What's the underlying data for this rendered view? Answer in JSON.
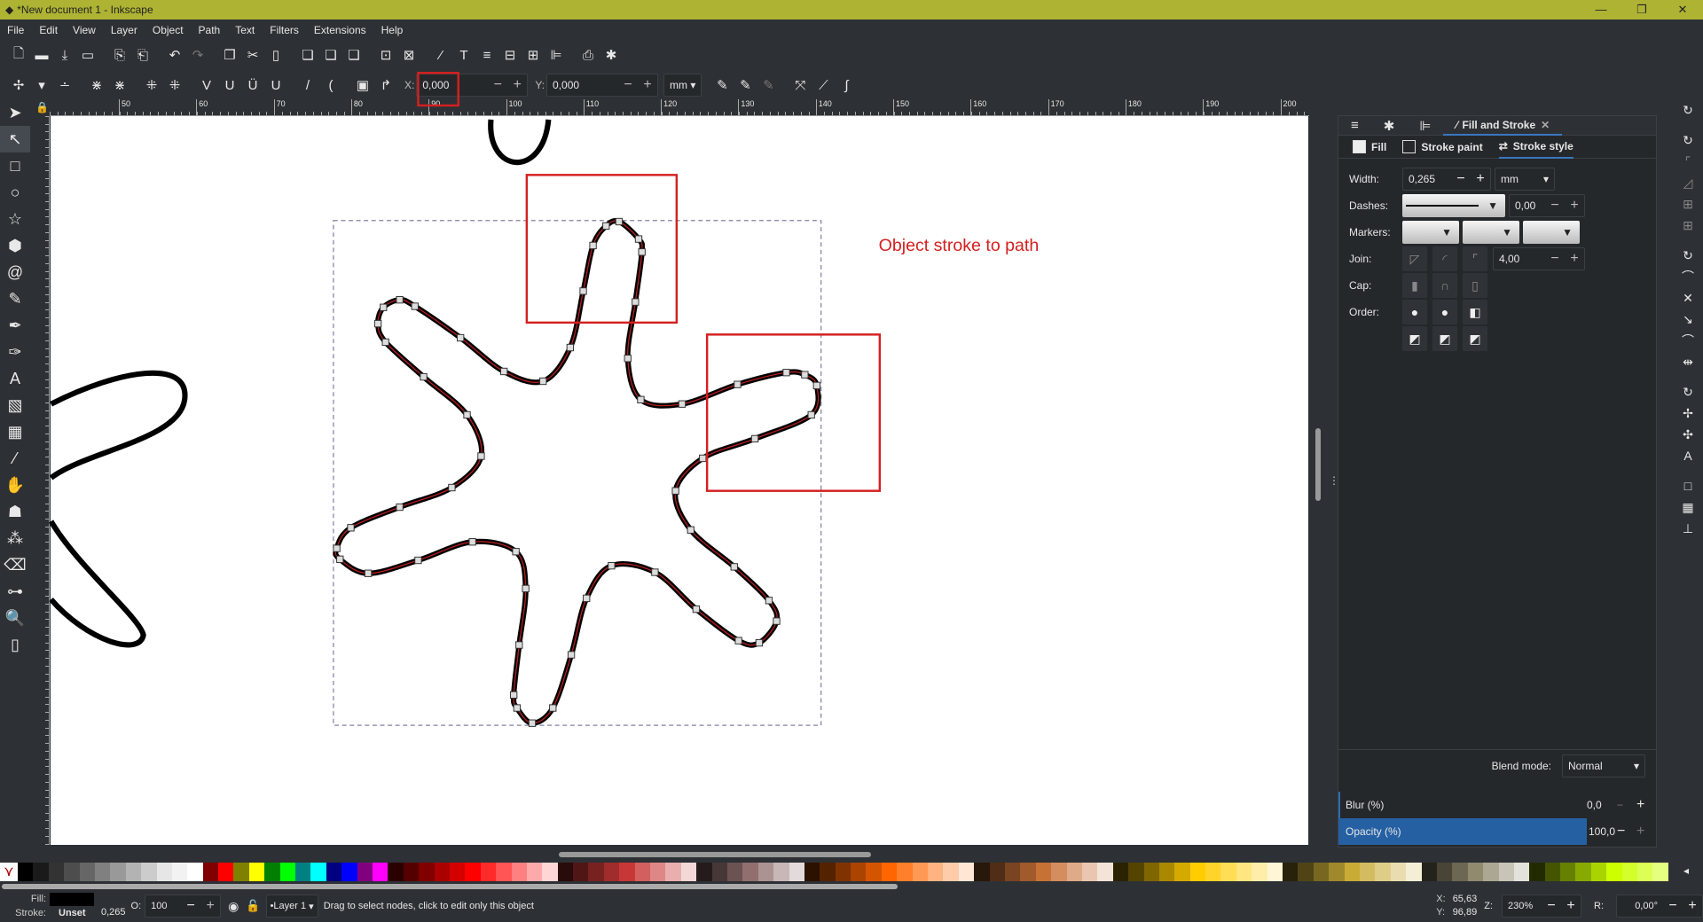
{
  "window": {
    "title": "*New document 1 - Inkscape",
    "min": "—",
    "max": "❐",
    "close": "✕"
  },
  "menu": [
    "File",
    "Edit",
    "View",
    "Layer",
    "Object",
    "Path",
    "Text",
    "Filters",
    "Extensions",
    "Help"
  ],
  "toolbar2": {
    "x_label": "X:",
    "x_value": "0,000",
    "y_label": "Y:",
    "y_value": "0,000",
    "unit": "mm"
  },
  "ruler_labels": [
    "50",
    "60",
    "70",
    "80",
    "90",
    "100",
    "110",
    "120",
    "130",
    "140",
    "150",
    "160",
    "170",
    "180",
    "190",
    "200"
  ],
  "annotation": "Object stroke to path",
  "panel": {
    "tabs": [
      "Fill and Stroke"
    ],
    "subtabs": [
      "Fill",
      "Stroke paint",
      "Stroke style"
    ],
    "width_label": "Width:",
    "width_value": "0,265",
    "width_unit": "mm",
    "dashes_label": "Dashes:",
    "dash_offset": "0,00",
    "markers_label": "Markers:",
    "join_label": "Join:",
    "miter": "4,00",
    "cap_label": "Cap:",
    "order_label": "Order:",
    "blend_label": "Blend mode:",
    "blend_value": "Normal",
    "blur_label": "Blur (%)",
    "blur_value": "0,0",
    "opacity_label": "Opacity (%)",
    "opacity_value": "100,0"
  },
  "palette": [
    "#000000",
    "#1a1a1a",
    "#333333",
    "#4d4d4d",
    "#666666",
    "#808080",
    "#999999",
    "#b3b3b3",
    "#cccccc",
    "#e6e6e6",
    "#f2f2f2",
    "#ffffff",
    "#800000",
    "#ff0000",
    "#808000",
    "#ffff00",
    "#008000",
    "#00ff00",
    "#008080",
    "#00ffff",
    "#000080",
    "#0000ff",
    "#800080",
    "#ff00ff",
    "#2b0000",
    "#550000",
    "#800000",
    "#aa0000",
    "#d40000",
    "#ff0000",
    "#ff2a2a",
    "#ff5555",
    "#ff8080",
    "#ffaaaa",
    "#ffd5d5",
    "#280b0b",
    "#501616",
    "#782121",
    "#a02c2c",
    "#c83737",
    "#d35f5f",
    "#de8787",
    "#e9afaf",
    "#f4d7d7",
    "#241c1c",
    "#483737",
    "#6c5353",
    "#916f6f",
    "#ac9393",
    "#c8b7b7",
    "#e3dbdb",
    "#2b1100",
    "#552200",
    "#803300",
    "#aa4400",
    "#d45500",
    "#ff6600",
    "#ff7f2a",
    "#ff9955",
    "#ffb380",
    "#ffccaa",
    "#ffe6d5",
    "#28170b",
    "#502d16",
    "#784421",
    "#a05a2c",
    "#c87137",
    "#d38d5f",
    "#deaa87",
    "#e9c6af",
    "#f4e3d7",
    "#2b2200",
    "#554400",
    "#806600",
    "#aa8800",
    "#d4aa00",
    "#ffcc00",
    "#ffd42a",
    "#ffdd55",
    "#ffe680",
    "#ffeeaa",
    "#fff6d5",
    "#28220b",
    "#504416",
    "#786721",
    "#a0892c",
    "#c8ab37",
    "#d3bc5f",
    "#decd87",
    "#e9ddaf",
    "#f4eed7",
    "#24221c",
    "#484537",
    "#6c6753",
    "#918a6f",
    "#aca793",
    "#c8c4b7",
    "#e3e2db",
    "#222b00",
    "#445500",
    "#668000",
    "#88aa00",
    "#aad400",
    "#ccff00",
    "#d4ff2a",
    "#ddff55",
    "#e5ff80"
  ],
  "status": {
    "fill_label": "Fill:",
    "stroke_label": "Stroke:",
    "stroke_value": "Unset",
    "stroke_width": "0,265",
    "opacity_label": "O:",
    "opacity_value": "100",
    "layer": "•Layer 1",
    "message": "Drag to select nodes, click to edit only this object",
    "x_label": "X:",
    "x_value": "65,63",
    "y_label": "Y:",
    "y_value": "96,89",
    "zoom_label": "Z:",
    "zoom_value": "230%",
    "rot_label": "R:",
    "rot_value": "0,00°"
  }
}
